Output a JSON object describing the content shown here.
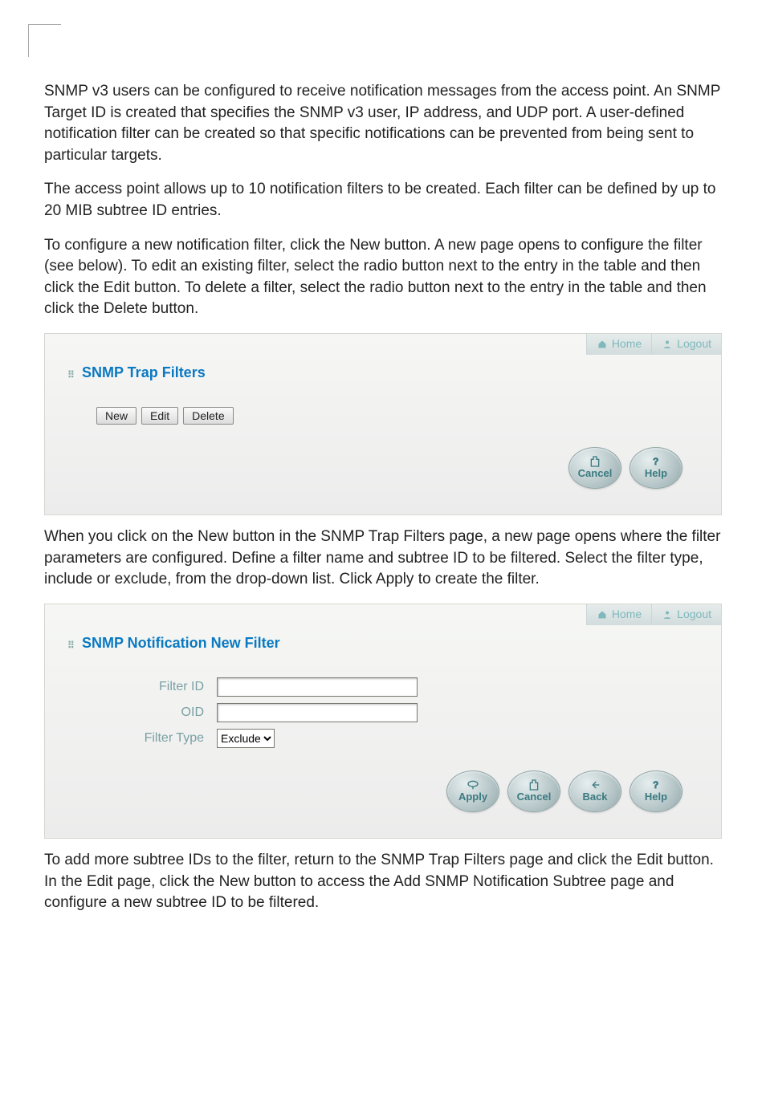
{
  "paragraphs": {
    "intro1": "SNMP v3 users can be configured to receive notification messages from the access point. An SNMP Target ID is created that specifies the SNMP v3 user, IP address, and UDP port. A user-defined notification filter can be created so that specific notifications can be prevented from being sent to particular targets.",
    "intro2": "The access point allows up to 10 notification filters to be created. Each filter can be defined by up to 20 MIB subtree ID entries.",
    "intro3": "To configure a new notification filter, click the New button. A new page opens to configure the filter (see below). To edit an existing filter, select the radio button next to the entry in the table and then click the Edit button. To delete a filter, select the radio button next to the entry in the table and then click the Delete button.",
    "mid": "When you click on the New button in the SNMP Trap Filters page, a new page opens where the filter parameters are configured. Define a filter name and subtree ID to be filtered. Select the filter type, include or exclude, from the drop-down list. Click Apply to create the filter.",
    "outro": "To add more subtree IDs to the filter, return to the SNMP Trap Filters page and click the Edit button. In the Edit page, click the New button to access the Add SNMP Notification Subtree page and configure a new subtree ID to be filtered."
  },
  "top_tabs": {
    "home": "Home",
    "logout": "Logout"
  },
  "panel1": {
    "title": "SNMP Trap Filters",
    "buttons": {
      "new": "New",
      "edit": "Edit",
      "delete": "Delete"
    },
    "pills": {
      "cancel": "Cancel",
      "help": "Help"
    }
  },
  "panel2": {
    "title": "SNMP Notification New Filter",
    "fields": {
      "filter_id_label": "Filter ID",
      "filter_id_value": "",
      "oid_label": "OID",
      "oid_value": "",
      "filter_type_label": "Filter Type",
      "filter_type_value": "Exclude"
    },
    "pills": {
      "apply": "Apply",
      "cancel": "Cancel",
      "back": "Back",
      "help": "Help"
    }
  }
}
